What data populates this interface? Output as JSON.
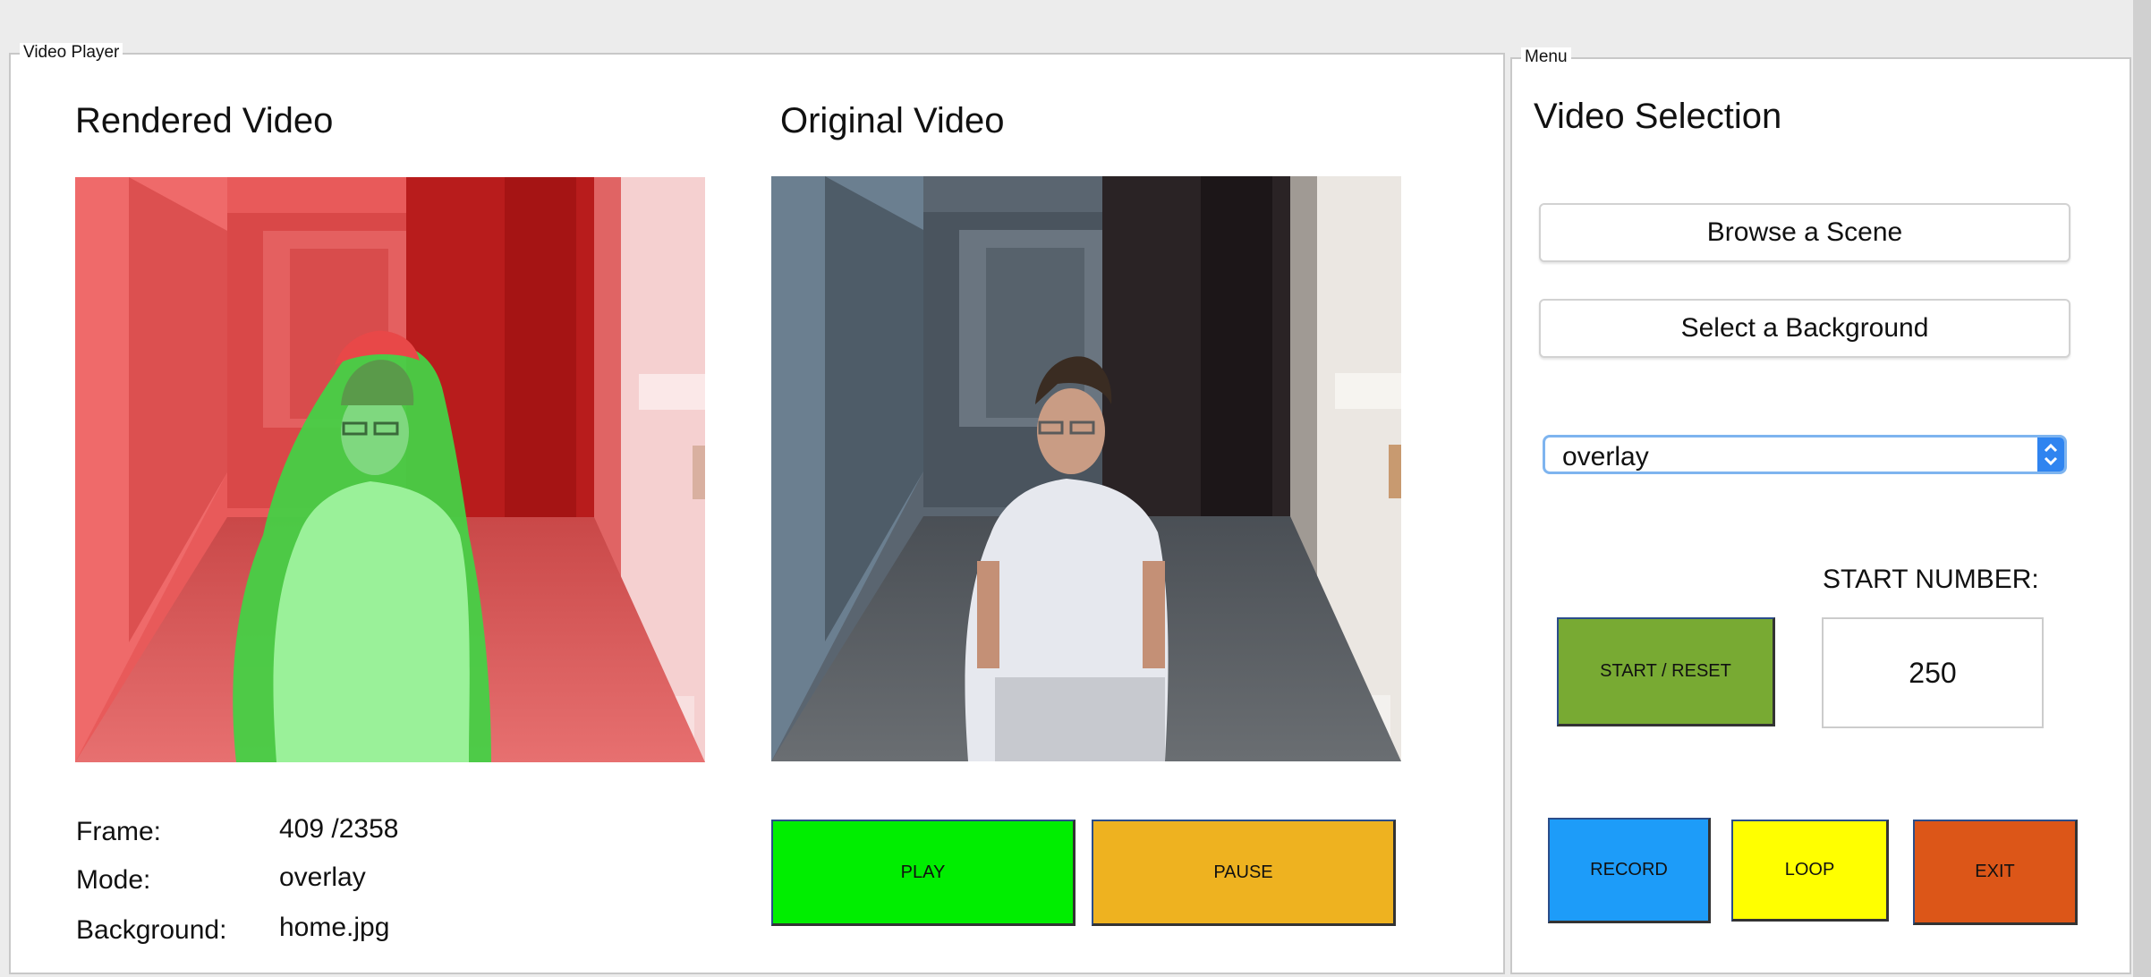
{
  "video_player": {
    "group_title": "Video Player",
    "rendered_heading": "Rendered Video",
    "original_heading": "Original Video",
    "info": {
      "frame_label": "Frame:",
      "frame_value": "409 /2358",
      "mode_label": "Mode:",
      "mode_value": "overlay",
      "background_label": "Background:",
      "background_value": "home.jpg"
    },
    "play_label": "PLAY",
    "pause_label": "PAUSE"
  },
  "menu": {
    "group_title": "Menu",
    "heading": "Video Selection",
    "browse_label": "Browse a Scene",
    "background_label": "Select a Background",
    "mode_select_value": "overlay",
    "start_number_label": "START NUMBER:",
    "start_number_value": "250",
    "start_reset_label": "START / RESET",
    "record_label": "RECORD",
    "loop_label": "LOOP",
    "exit_label": "EXIT"
  },
  "colors": {
    "play": "#00ee00",
    "pause": "#eeb220",
    "start_reset": "#78aa33",
    "record": "#1d9cf9",
    "loop": "#ffff00",
    "exit": "#dc5618",
    "overlay_background": "#e84040",
    "overlay_foreground": "#58e058"
  }
}
